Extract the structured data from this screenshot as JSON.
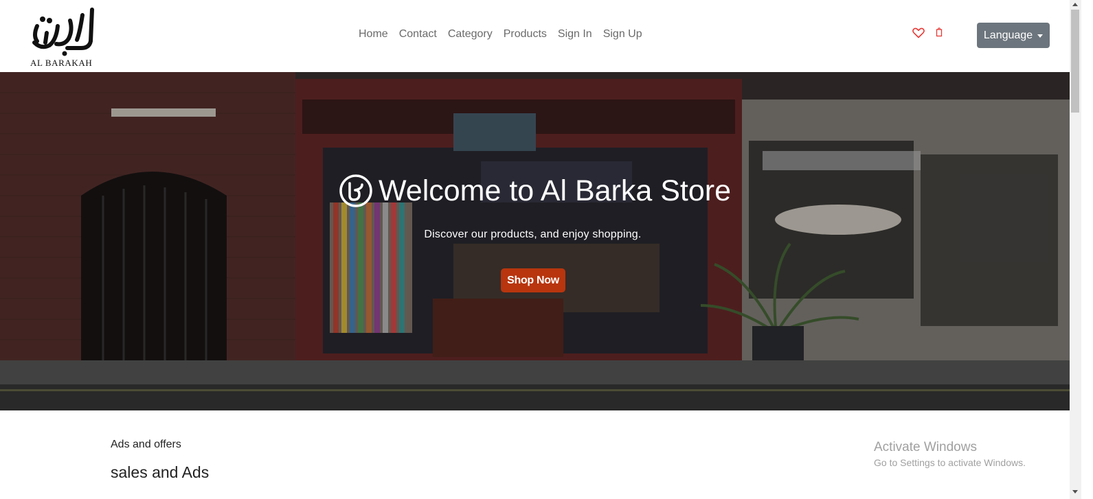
{
  "brand": {
    "name": "AL BARAKAH",
    "logo_icon": "al-barakah-arabic-logo"
  },
  "nav": {
    "links": [
      "Home",
      "Contact",
      "Category",
      "Products",
      "Sign In",
      "Sign Up"
    ]
  },
  "header_icons": {
    "wishlist": "heart-icon",
    "cart": "shopping-bag-icon",
    "accent_color": "#e53935"
  },
  "language_button": {
    "label": "Language"
  },
  "hero": {
    "title": "Welcome to Al Barka Store",
    "subtitle": "Discover our products, and enjoy shopping.",
    "button": "Shop Now",
    "button_color": "#b8350e"
  },
  "section": {
    "label": "Ads and offers",
    "heading": "sales and Ads"
  },
  "watermark": {
    "title": "Activate Windows",
    "subtitle": "Go to Settings to activate Windows."
  }
}
